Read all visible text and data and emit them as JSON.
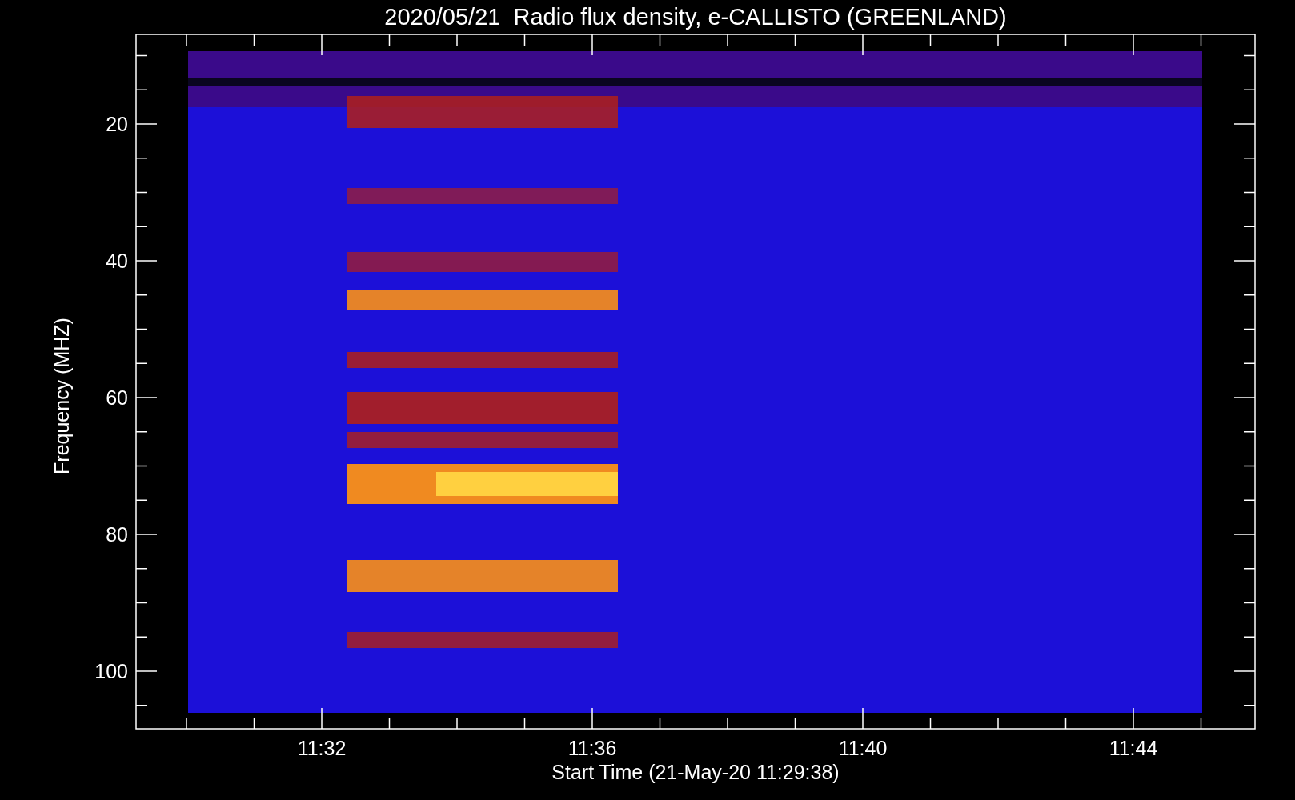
{
  "plot": {
    "title": "2020/05/21  Radio flux density, e-CALLISTO (GREENLAND)",
    "y_axis": {
      "label": "Frequency (MHZ)",
      "ticks": [
        "20",
        "40",
        "60",
        "80",
        "100"
      ]
    },
    "x_axis": {
      "label": "Start Time (21-May-20 11:29:38)",
      "ticks": [
        "11:32",
        "11:36",
        "11:40",
        "11:44"
      ]
    }
  }
}
